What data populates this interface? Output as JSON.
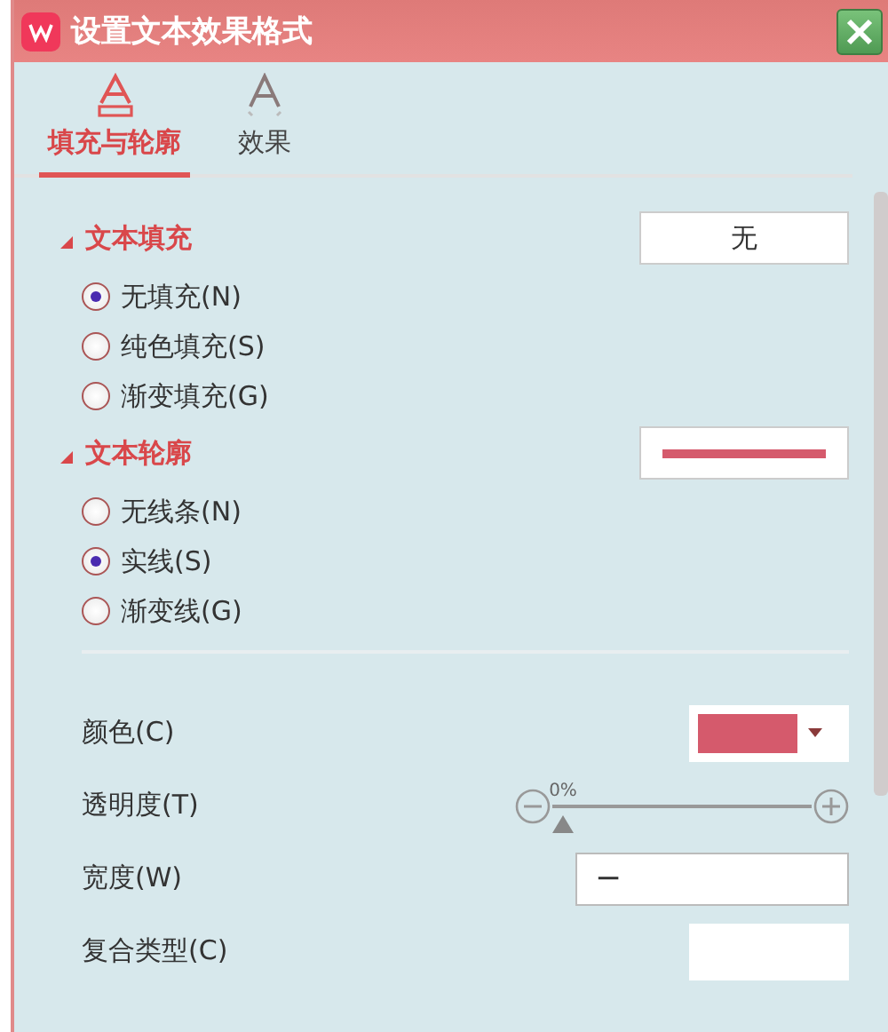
{
  "window": {
    "title": "设置文本效果格式"
  },
  "tabs": [
    {
      "label": "填充与轮廓",
      "selected": true
    },
    {
      "label": "效果",
      "selected": false
    }
  ],
  "sections": [
    {
      "title": "文本填充",
      "expanded": true,
      "preview": {
        "kind": "text",
        "text": "无"
      },
      "options": [
        {
          "label": "无填充(N)",
          "selected": true
        },
        {
          "label": "纯色填充(S)",
          "selected": false
        },
        {
          "label": "渐变填充(G)",
          "selected": false
        }
      ]
    },
    {
      "title": "文本轮廓",
      "expanded": true,
      "preview": {
        "kind": "line"
      },
      "options": [
        {
          "label": "无线条(N)",
          "selected": false
        },
        {
          "label": "实线(S)",
          "selected": true
        },
        {
          "label": "渐变线(G)",
          "selected": false
        }
      ]
    }
  ],
  "properties": [
    {
      "kind": "color",
      "label": "颜色(C)",
      "color": "#d55a6c"
    },
    {
      "kind": "slider",
      "label": "透明度(T)",
      "level": 0,
      "reading": "0%"
    },
    {
      "kind": "spinner",
      "label": "宽度(W)",
      "value": "−"
    },
    {
      "kind": "dropdown",
      "label": "复合类型(C)"
    }
  ]
}
